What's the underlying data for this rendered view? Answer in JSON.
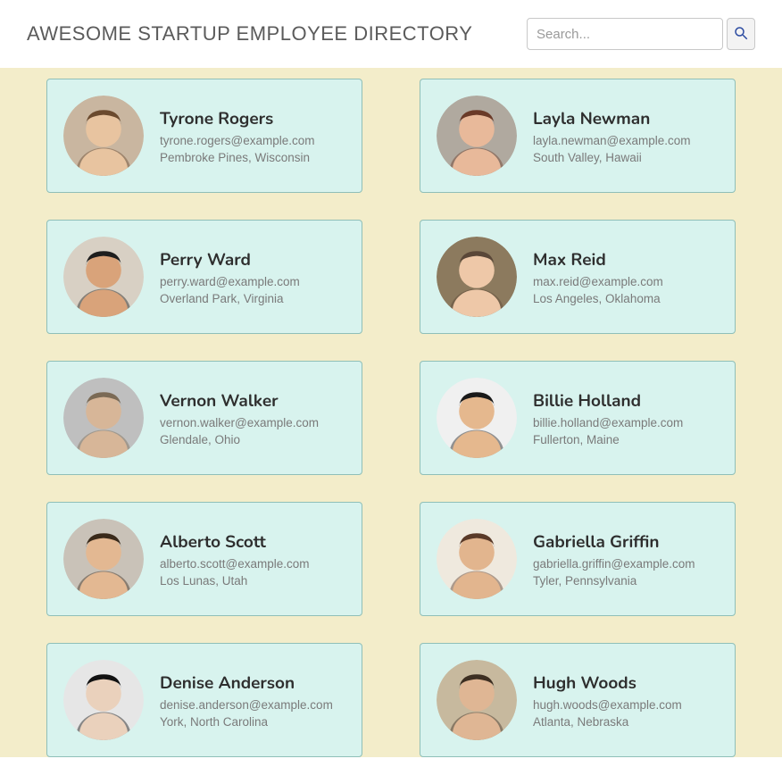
{
  "header": {
    "title": "AWESOME STARTUP EMPLOYEE DIRECTORY",
    "search_placeholder": "Search..."
  },
  "employees": [
    {
      "name": "Tyrone Rogers",
      "email": "tyrone.rogers@example.com",
      "location": "Pembroke Pines, Wisconsin",
      "avatar": {
        "bg": "#c9b6a0",
        "skin": "#e8c4a0",
        "hair": "#6b4a2e"
      }
    },
    {
      "name": "Layla Newman",
      "email": "layla.newman@example.com",
      "location": "South Valley, Hawaii",
      "avatar": {
        "bg": "#b0a99f",
        "skin": "#e8b99a",
        "hair": "#6a3a28"
      }
    },
    {
      "name": "Perry Ward",
      "email": "perry.ward@example.com",
      "location": "Overland Park, Virginia",
      "avatar": {
        "bg": "#d8d0c4",
        "skin": "#d9a37a",
        "hair": "#1e1e1e"
      }
    },
    {
      "name": "Max Reid",
      "email": "max.reid@example.com",
      "location": "Los Angeles, Oklahoma",
      "avatar": {
        "bg": "#8c7a5e",
        "skin": "#eec8a8",
        "hair": "#5a4738"
      }
    },
    {
      "name": "Vernon Walker",
      "email": "vernon.walker@example.com",
      "location": "Glendale, Ohio",
      "avatar": {
        "bg": "#bfbfbf",
        "skin": "#d7b698",
        "hair": "#7b6a55"
      }
    },
    {
      "name": "Billie Holland",
      "email": "billie.holland@example.com",
      "location": "Fullerton, Maine",
      "avatar": {
        "bg": "#f0f0f0",
        "skin": "#e5b88e",
        "hair": "#1a1a1a"
      }
    },
    {
      "name": "Alberto Scott",
      "email": "alberto.scott@example.com",
      "location": "Los Lunas, Utah",
      "avatar": {
        "bg": "#c9c2b8",
        "skin": "#e3b892",
        "hair": "#3a2a1a"
      }
    },
    {
      "name": "Gabriella Griffin",
      "email": "gabriella.griffin@example.com",
      "location": "Tyler, Pennsylvania",
      "avatar": {
        "bg": "#efe9de",
        "skin": "#e2b58e",
        "hair": "#5a3a28"
      }
    },
    {
      "name": "Denise Anderson",
      "email": "denise.anderson@example.com",
      "location": "York, North Carolina",
      "avatar": {
        "bg": "#e6e6e6",
        "skin": "#ead1bc",
        "hair": "#111111"
      }
    },
    {
      "name": "Hugh Woods",
      "email": "hugh.woods@example.com",
      "location": "Atlanta, Nebraska",
      "avatar": {
        "bg": "#c7b99e",
        "skin": "#dfb694",
        "hair": "#3d2f22"
      }
    }
  ]
}
